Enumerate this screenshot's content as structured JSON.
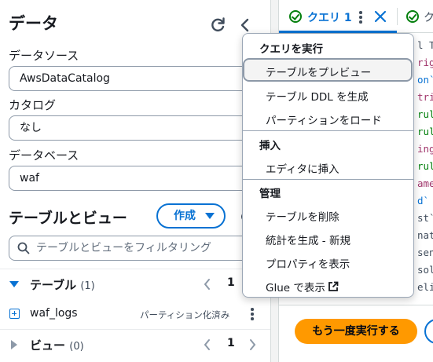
{
  "left_panel": {
    "title": "データ",
    "data_source": {
      "label": "データソース",
      "value": "AwsDataCatalog"
    },
    "catalog": {
      "label": "カタログ",
      "value": "なし"
    },
    "database": {
      "label": "データベース",
      "value": "waf"
    },
    "tables_views": {
      "title": "テーブルとビュー",
      "create_label": "作成",
      "filter_placeholder": "テーブルとビューをフィルタリング",
      "tables": {
        "label": "テーブル",
        "count": "(1)",
        "page": "1",
        "expanded": true
      },
      "table_item": {
        "name": "waf_logs",
        "badge": "パーティション化済み"
      },
      "views": {
        "label": "ビュー",
        "count": "(0)",
        "page": "1",
        "expanded": false
      }
    }
  },
  "editor": {
    "tabs": [
      {
        "label": "クエリ 1",
        "status": "success",
        "active": true
      },
      {
        "label": "ク",
        "status": "success",
        "active": false
      }
    ],
    "code_fragments": [
      "l TA",
      "rigi",
      "on`",
      "trin",
      "rule",
      "rule",
      "ing,",
      "rule",
      "ame`",
      "d` s",
      "st`",
      "nato",
      "sens",
      "solv",
      "elie"
    ],
    "run_again_label": "もう一度実行する"
  },
  "context_menu": {
    "groups": [
      {
        "header": "クエリを実行",
        "items": [
          "テーブルをプレビュー",
          "テーブル DDL を生成",
          "パーティションをロード"
        ]
      },
      {
        "header": "挿入",
        "items": [
          "エディタに挿入"
        ]
      },
      {
        "header": "管理",
        "items": [
          "テーブルを削除",
          "統計を生成 - 新規",
          "プロパティを表示",
          "Glue で表示"
        ]
      }
    ],
    "highlighted_item": "テーブルをプレビュー"
  },
  "colors": {
    "accent": "#0972d3",
    "success": "#037f0c",
    "primary_button": "#ff9900",
    "text": "#16191f",
    "border": "#8d99a8"
  },
  "icons": [
    "refresh-icon",
    "chevron-left-icon",
    "caret-down-icon",
    "settings-icon",
    "search-icon",
    "chevron-right-icon",
    "expand-plus-icon",
    "kebab-icon",
    "success-check-icon",
    "close-icon",
    "external-link-icon"
  ]
}
